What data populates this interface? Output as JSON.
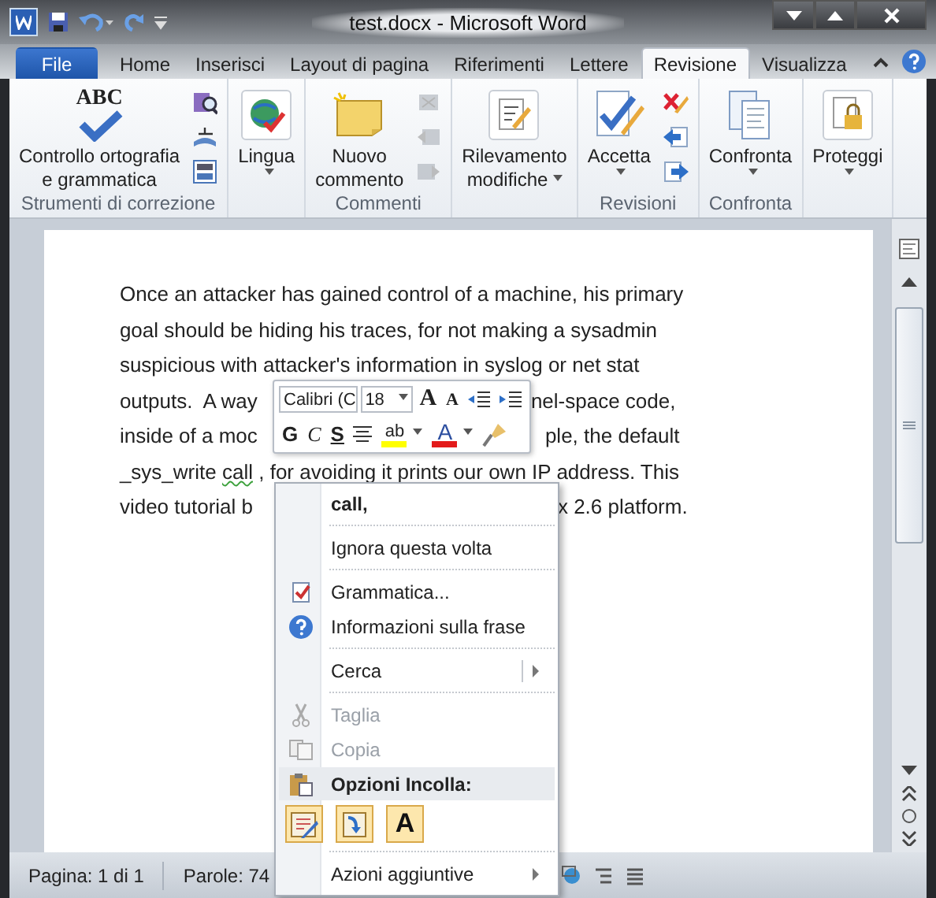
{
  "window": {
    "title": "test.docx  -  Microsoft Word"
  },
  "ribbon_tabs": [
    {
      "label": "File",
      "kind": "file",
      "selected": false
    },
    {
      "label": "Home",
      "kind": "tab",
      "selected": false
    },
    {
      "label": "Inserisci",
      "kind": "tab",
      "selected": false
    },
    {
      "label": "Layout di pagina",
      "kind": "tab",
      "selected": false
    },
    {
      "label": "Riferimenti",
      "kind": "tab",
      "selected": false
    },
    {
      "label": "Lettere",
      "kind": "tab",
      "selected": false
    },
    {
      "label": "Revisione",
      "kind": "tab",
      "selected": true
    },
    {
      "label": "Visualizza",
      "kind": "tab",
      "selected": false
    }
  ],
  "ribbon_groups": [
    {
      "label": "Strumenti di correzione",
      "large": [
        {
          "lines": [
            "Controllo ortografia",
            "e grammatica"
          ],
          "icon_text": "ABC",
          "dropdown": false
        }
      ],
      "small": [
        {
          "disabled": false
        },
        {
          "disabled": false
        },
        {
          "disabled": false
        }
      ]
    },
    {
      "large": [
        {
          "lines": [
            "Lingua"
          ],
          "dropdown": true
        }
      ]
    },
    {
      "label": "Commenti",
      "large": [
        {
          "lines": [
            "Nuovo",
            "commento"
          ],
          "dropdown": false
        }
      ],
      "small": [
        {
          "disabled": true
        },
        {
          "disabled": true
        },
        {
          "disabled": true
        }
      ]
    },
    {
      "large": [
        {
          "lines": [
            "Rilevamento",
            "modifiche"
          ],
          "dropdown": true
        }
      ]
    },
    {
      "label": "Revisioni",
      "large": [
        {
          "lines": [
            "Accetta"
          ],
          "dropdown": true
        }
      ],
      "small": [
        {
          "disabled": false
        },
        {
          "disabled": false
        },
        {
          "disabled": false
        }
      ]
    },
    {
      "label": "Confronta",
      "large": [
        {
          "lines": [
            "Confronta"
          ],
          "dropdown": true
        }
      ]
    },
    {
      "large": [
        {
          "lines": [
            "Proteggi"
          ],
          "dropdown": true
        }
      ]
    }
  ],
  "document": {
    "lines": [
      {
        "left": [
          {
            "text": "Once an attacker has gained control of a machine, his primary",
            "grammar_error": false
          }
        ]
      },
      {
        "left": [
          {
            "text": "goal should be hiding his traces, for not making a sysadmin",
            "grammar_error": false
          }
        ]
      },
      {
        "left": [
          {
            "text": "suspicious with attacker's information in syslog or net stat",
            "grammar_error": false
          }
        ]
      },
      {
        "left": [
          {
            "text": "outputs.  A way",
            "grammar_error": false
          }
        ],
        "right": [
          {
            "text": "nel-space code,",
            "grammar_error": false
          }
        ]
      },
      {
        "left": [
          {
            "text": "inside of a moc",
            "grammar_error": false
          }
        ],
        "right": [
          {
            "text": "ple, the default",
            "grammar_error": false
          }
        ]
      },
      {
        "left": [
          {
            "text": "_sys_write ",
            "grammar_error": false
          },
          {
            "text": "call",
            "grammar_error": true
          },
          {
            "text": " , for avoiding it prints our own IP address. This",
            "grammar_error": false
          }
        ]
      },
      {
        "left": [
          {
            "text": "video tutorial b",
            "grammar_error": false
          }
        ],
        "right": [
          {
            "text": "x 2.6 platform.",
            "grammar_error": false
          }
        ]
      }
    ]
  },
  "mini_toolbar": {
    "font_name": "Calibri (C",
    "font_size": "18",
    "row1_buttons": [
      {
        "kind": "grow-font",
        "label": "A"
      },
      {
        "kind": "shrink-font",
        "label": "A"
      },
      {
        "kind": "decrease-indent"
      },
      {
        "kind": "increase-indent"
      }
    ],
    "row2_buttons": [
      {
        "kind": "bold",
        "label": "G"
      },
      {
        "kind": "italic",
        "label": "C"
      },
      {
        "kind": "underline",
        "label": "S"
      },
      {
        "kind": "center"
      },
      {
        "kind": "highlight",
        "label": "ab",
        "color": "#ffff00",
        "dropdown": true
      },
      {
        "kind": "font-color",
        "label": "A",
        "color": "#e31b1b",
        "dropdown": true
      },
      {
        "kind": "format-painter"
      }
    ]
  },
  "context_menu": {
    "items": [
      {
        "kind": "suggestion",
        "label": "call,"
      },
      {
        "kind": "separator"
      },
      {
        "kind": "item",
        "label": "Ignora questa volta",
        "disabled": false
      },
      {
        "kind": "separator"
      },
      {
        "kind": "item",
        "label": "Grammatica...",
        "disabled": false
      },
      {
        "kind": "item",
        "label": "Informazioni sulla frase",
        "disabled": false
      },
      {
        "kind": "separator"
      },
      {
        "kind": "submenu",
        "label": "Cerca",
        "disabled": false
      },
      {
        "kind": "separator"
      },
      {
        "kind": "item",
        "label": "Taglia",
        "disabled": true
      },
      {
        "kind": "item",
        "label": "Copia",
        "disabled": true
      },
      {
        "kind": "header",
        "label": "Opzioni Incolla:"
      },
      {
        "kind": "paste-options",
        "options": [
          {
            "kind": "keep-formatting"
          },
          {
            "kind": "merge"
          },
          {
            "kind": "text-only",
            "label": "A"
          }
        ]
      },
      {
        "kind": "separator"
      },
      {
        "kind": "submenu",
        "label": "Azioni aggiuntive",
        "disabled": false
      }
    ]
  },
  "status_bar": {
    "items": [
      "Pagina: 1 di 1",
      "Parole: 74"
    ]
  }
}
